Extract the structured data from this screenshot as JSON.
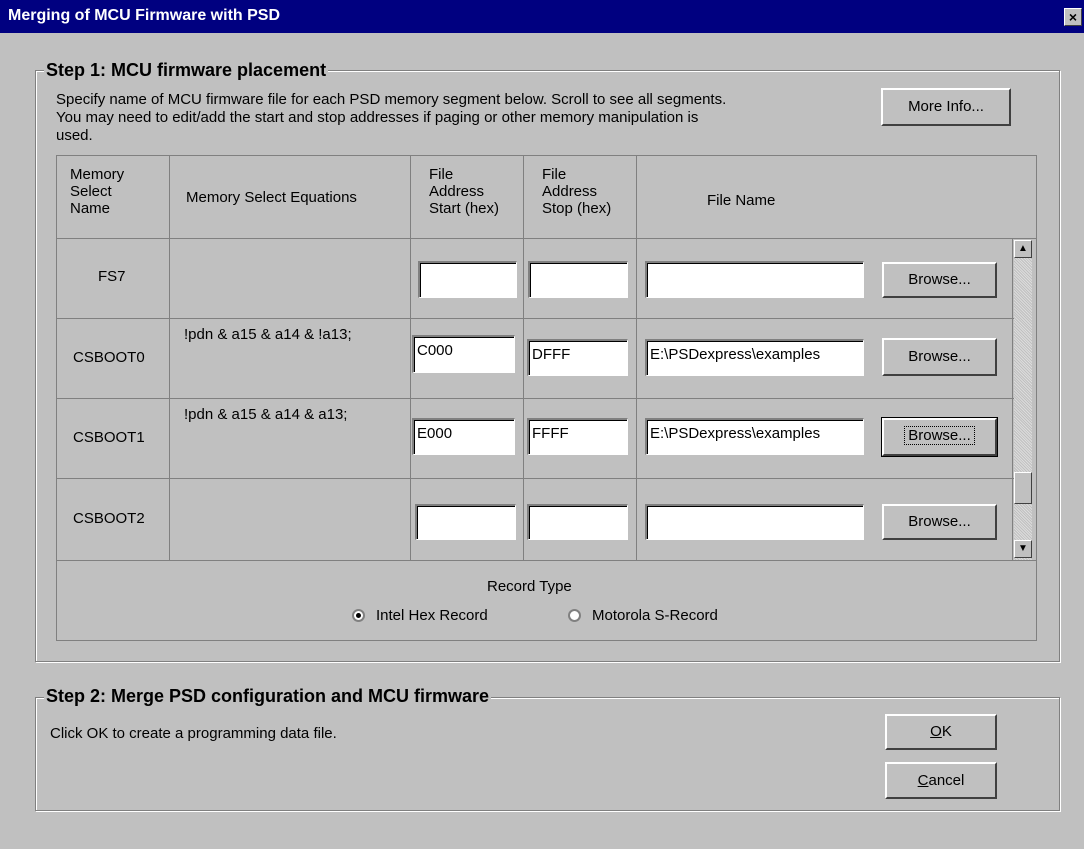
{
  "window": {
    "title": "Merging of MCU Firmware with PSD",
    "close_glyph": "×"
  },
  "step1": {
    "title": "Step 1: MCU firmware placement",
    "instructions_line1": "Specify name of MCU firmware file for each PSD memory segment below. Scroll to see all segments.",
    "instructions_line2": "You may need to edit/add the start and stop addresses if paging or other memory manipulation is",
    "instructions_line3": "used.",
    "more_info_label": "More Info...",
    "headers": {
      "name": [
        "Memory",
        "Select",
        "Name"
      ],
      "equations": "Memory Select Equations",
      "start": [
        "File",
        "Address",
        "Start (hex)"
      ],
      "stop": [
        "File",
        "Address",
        "Stop (hex)"
      ],
      "file": "File Name"
    },
    "rows": [
      {
        "name": "FS7",
        "equation": "",
        "start": "",
        "stop": "",
        "file": "",
        "browse": "Browse..."
      },
      {
        "name": "CSBOOT0",
        "equation": "!pdn & a15 & a14 & !a13;",
        "start": "C000",
        "stop": "DFFF",
        "file": "E:\\PSDexpress\\examples",
        "browse": "Browse..."
      },
      {
        "name": "CSBOOT1",
        "equation": "!pdn & a15 & a14 & a13;",
        "start": "E000",
        "stop": "FFFF",
        "file": "E:\\PSDexpress\\examples",
        "browse": "Browse..."
      },
      {
        "name": "CSBOOT2",
        "equation": "",
        "start": "",
        "stop": "",
        "file": "",
        "browse": "Browse..."
      }
    ],
    "record_type": {
      "label": "Record Type",
      "options": [
        "Intel Hex Record",
        "Motorola S-Record"
      ],
      "selected": "Intel Hex Record"
    }
  },
  "step2": {
    "title": "Step 2: Merge PSD configuration and MCU firmware",
    "instructions": "Click OK to create a programming data file.",
    "ok_label": "OK",
    "cancel_label": "Cancel"
  }
}
